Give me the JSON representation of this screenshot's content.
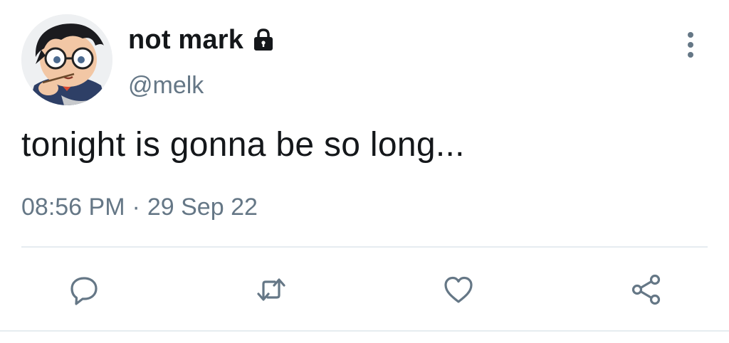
{
  "user": {
    "display_name": "not mark",
    "handle": "@melk",
    "avatar_icon": "anime-boy-with-glasses-avatar",
    "protected_icon": "lock-icon"
  },
  "tweet": {
    "text": "tonight is gonna be so long...",
    "time": "08:56 PM",
    "separator": "·",
    "date": "29 Sep 22"
  },
  "actions": {
    "reply_icon": "reply-icon",
    "retweet_icon": "retweet-icon",
    "like_icon": "heart-icon",
    "share_icon": "share-icon",
    "more_icon": "more-vertical-icon"
  },
  "colors": {
    "text": "#14171a",
    "secondary": "#657786",
    "divider": "#e6ecf0",
    "icon": "#657786"
  }
}
